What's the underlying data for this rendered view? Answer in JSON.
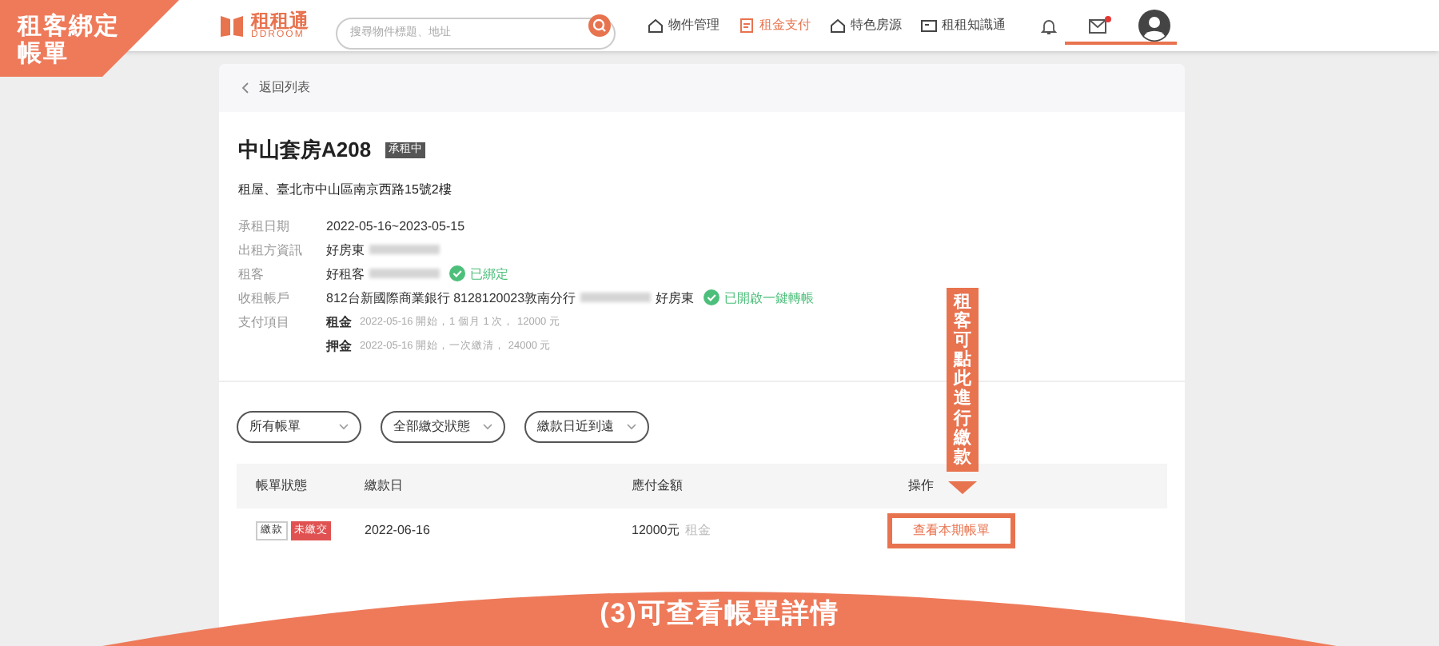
{
  "banner": {
    "text": "租客綁定帳單"
  },
  "header": {
    "logo": {
      "name": "租租通",
      "sub": "DDROOM"
    },
    "search": {
      "placeholder": "搜尋物件標題、地址"
    },
    "nav": [
      {
        "label": "物件管理",
        "kind": "house",
        "selected": false
      },
      {
        "label": "租金支付",
        "kind": "bill",
        "selected": true
      },
      {
        "label": "特色房源",
        "kind": "house",
        "selected": false
      },
      {
        "label": "租租知識通",
        "kind": "board",
        "selected": false
      }
    ],
    "mail_unread": true
  },
  "back_link": "返回列表",
  "property": {
    "title": "中山套房A208",
    "status": "承租中",
    "address": "租屋、臺北市中山區南京西路15號2樓"
  },
  "details": [
    {
      "label": "承租日期",
      "value": "2022-05-16~2023-05-15"
    },
    {
      "label": "出租方資訊",
      "value": "好房東",
      "redacted": true
    },
    {
      "label": "租客",
      "value": "好租客",
      "redacted": true,
      "verified": "已綁定"
    },
    {
      "label": "收租帳戶",
      "value": "812台新國際商業銀行 8128120023敦南分行",
      "redacted": true,
      "suffix": "好房東",
      "verified": "已開啟一鍵轉帳"
    },
    {
      "label": "支付項目",
      "items": [
        {
          "name": "租金",
          "note": "2022-05-16 開始，1 個月 1 次， 12000 元"
        },
        {
          "name": "押金",
          "note": "2022-05-16 開始，一次繳清， 24000 元"
        }
      ]
    }
  ],
  "filters": [
    "所有帳單",
    "全部繳交狀態",
    "繳款日近到遠"
  ],
  "table": {
    "columns": [
      "帳單狀態",
      "繳款日",
      "應付金額",
      "操作"
    ],
    "rows": [
      {
        "type_tag": "繳款",
        "status": "未繳交",
        "due_date": "2022-06-16",
        "amount": "12000元",
        "amount_note": "租金",
        "action": "查看本期帳單",
        "highlighted": true
      }
    ]
  },
  "callout": "租客可點此進行繳款",
  "caption": "(3)可查看帳單詳情"
}
